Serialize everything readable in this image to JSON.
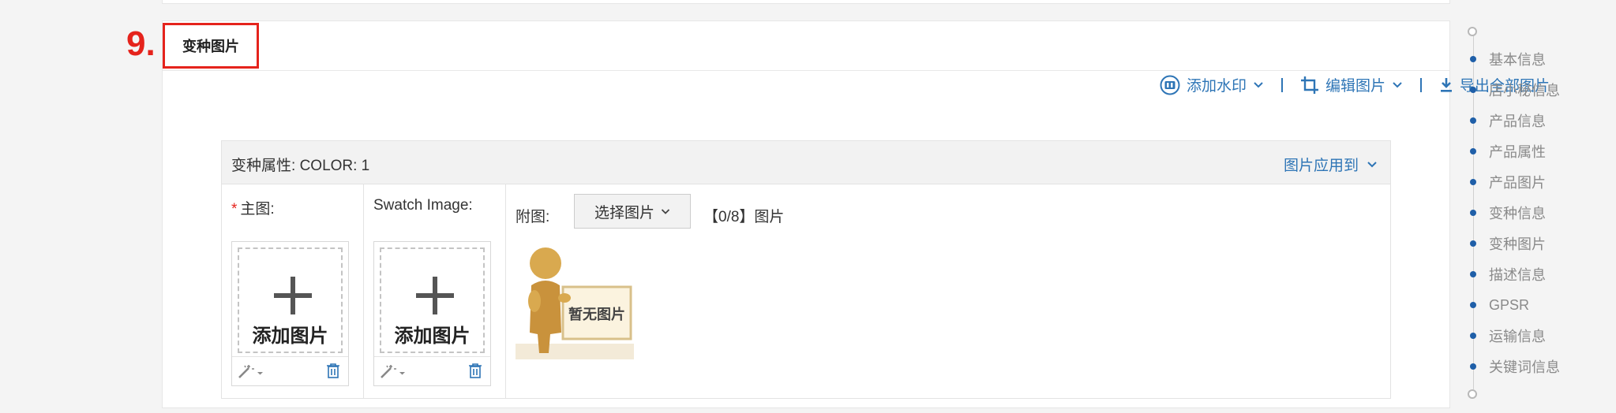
{
  "section": {
    "step_number": "9.",
    "title": "变种图片"
  },
  "toolbar": {
    "watermark_label": "添加水印",
    "edit_image_label": "编辑图片",
    "export_all_label": "导出全部图片"
  },
  "variant": {
    "attr_label": "变种属性:",
    "attr_value": "COLOR: 1",
    "apply_to_label": "图片应用到",
    "main_image_label": "主图:",
    "swatch_image_label": "Swatch Image:",
    "add_image_label": "添加图片",
    "attached_label": "附图:",
    "select_image_label": "选择图片",
    "image_count": "【0/8】图片",
    "no_image_text": "暂无图片"
  },
  "nav": {
    "items": [
      "基本信息",
      "店小秘信息",
      "产品信息",
      "产品属性",
      "产品图片",
      "变种信息",
      "变种图片",
      "描述信息",
      "GPSR",
      "运输信息",
      "关键词信息"
    ]
  },
  "colors": {
    "accent_red": "#e5231c",
    "link_blue": "#2e75b6",
    "nav_dot": "#1f5fa8"
  }
}
